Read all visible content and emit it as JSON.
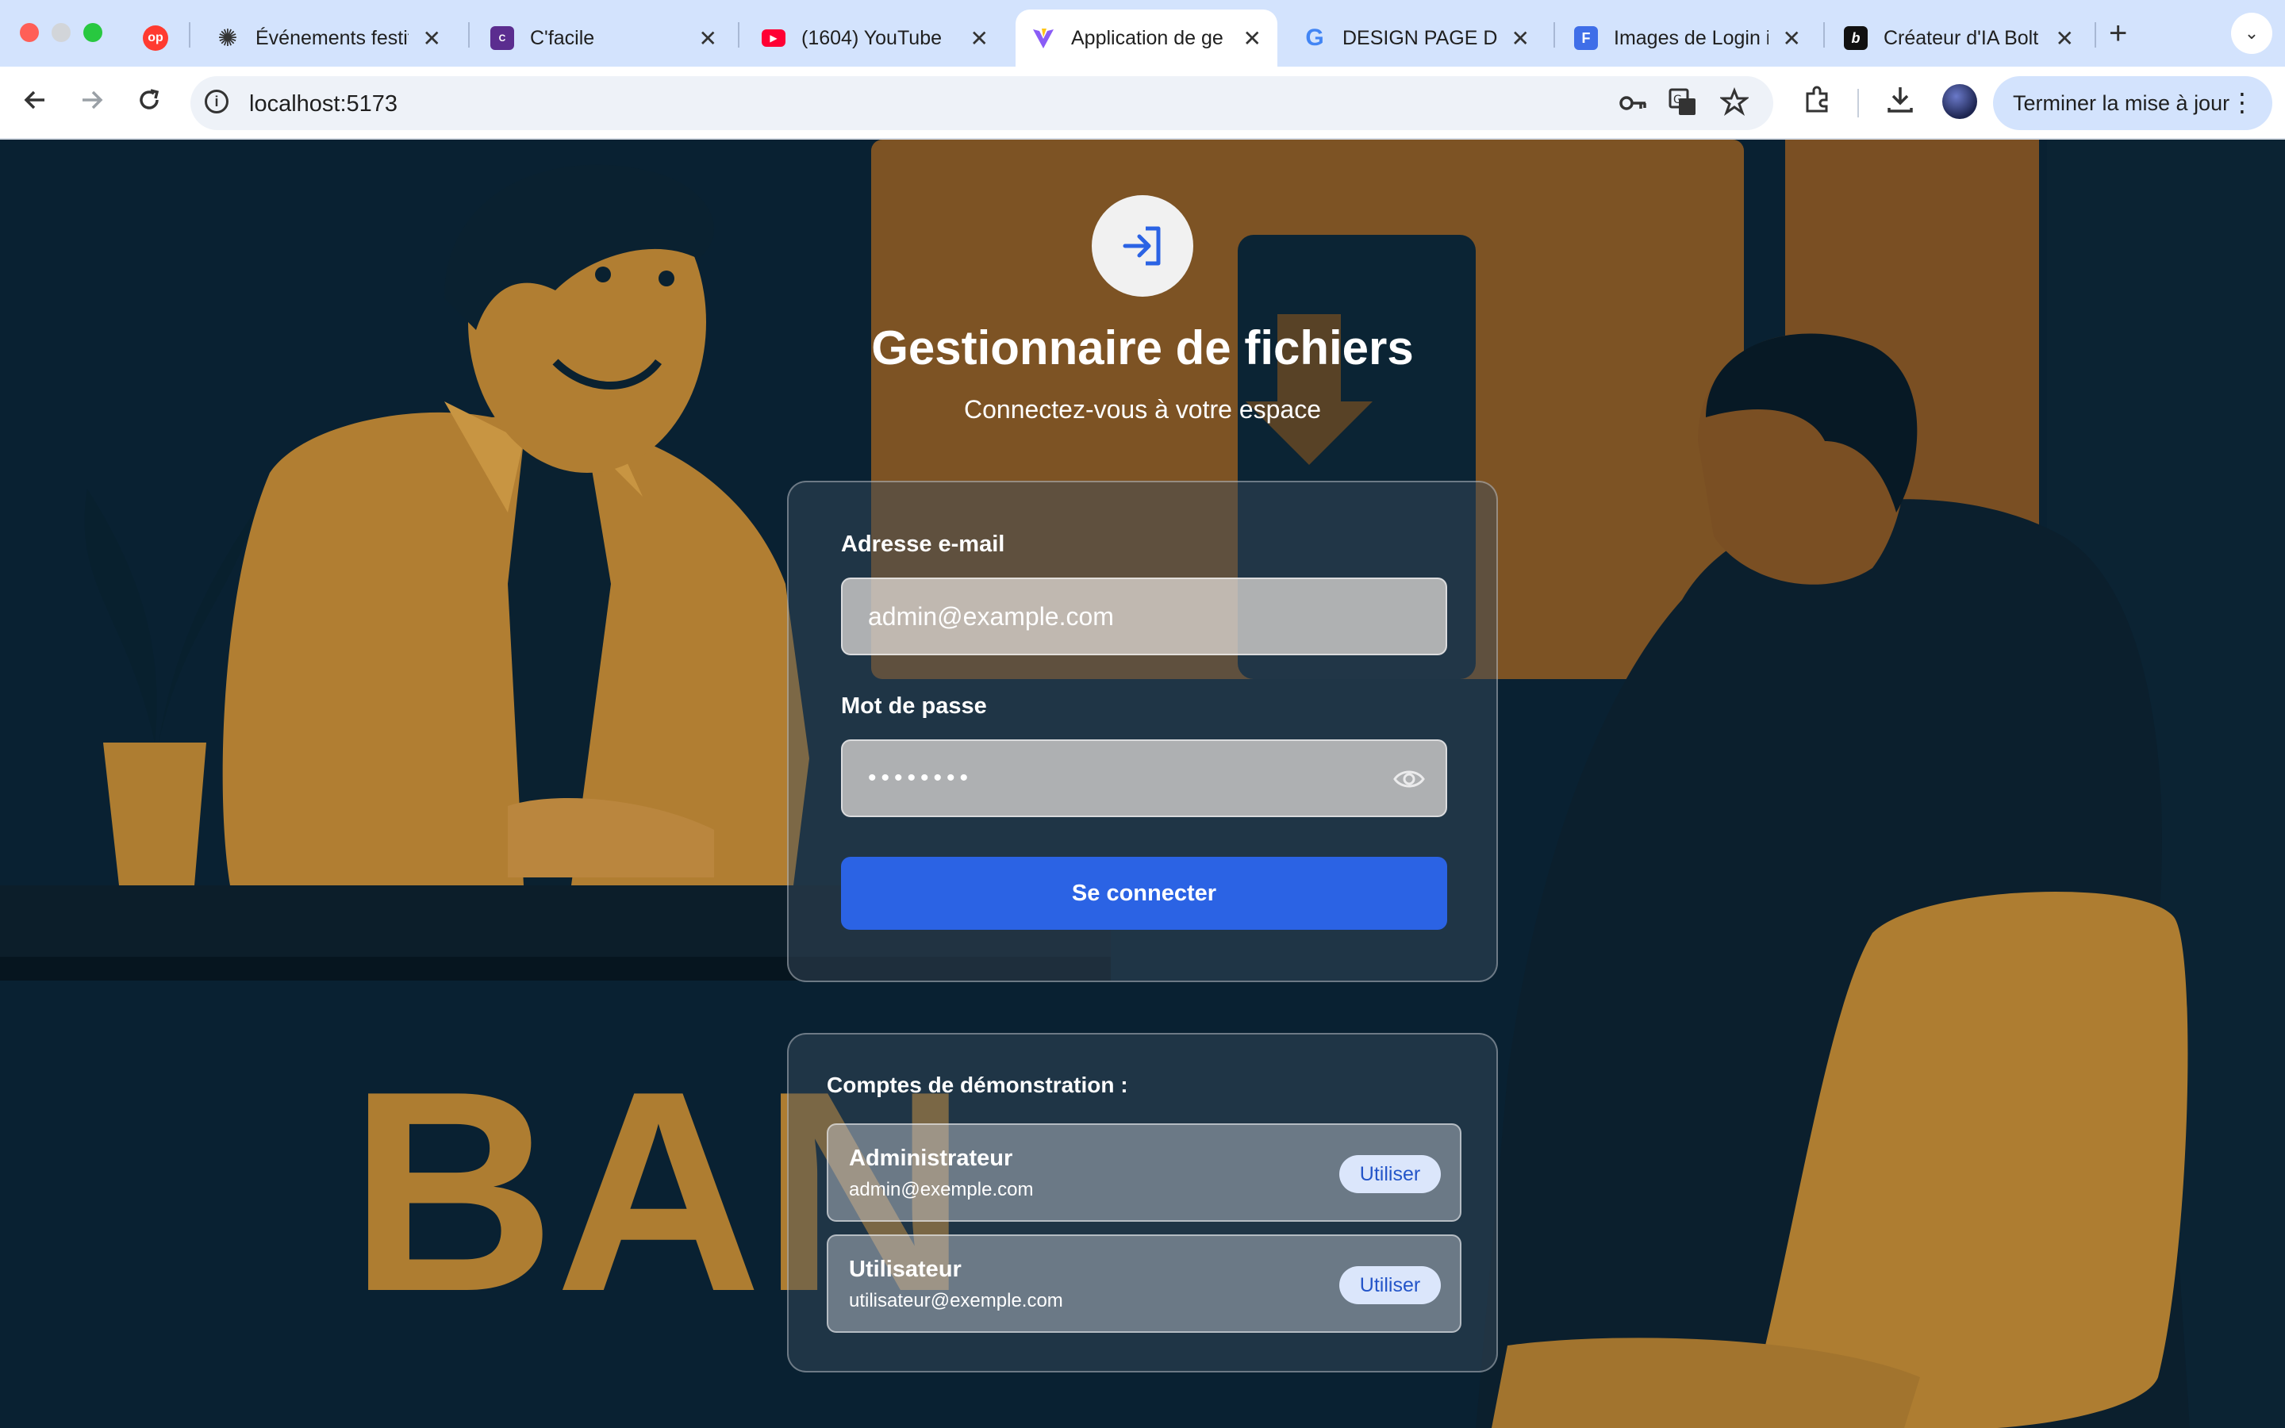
{
  "browser": {
    "tabs": [
      {
        "title": "Événements festif",
        "favicon": "op-icon",
        "favicon_text": "op",
        "favicon_color": "#ff3b30",
        "active": false
      },
      {
        "title": "C'facile",
        "favicon": "cfacile-icon",
        "favicon_text": "C",
        "favicon_color": "#5b2d8f",
        "active": false
      },
      {
        "title": "(1604) YouTube",
        "favicon": "youtube-icon",
        "favicon_text": "▶",
        "favicon_color": "#ff0033",
        "active": false
      },
      {
        "title": "Application de ge",
        "favicon": "vite-icon",
        "favicon_text": "V",
        "favicon_color": "#9b59f6",
        "active": true
      },
      {
        "title": "DESIGN PAGE DE",
        "favicon": "google-icon",
        "favicon_text": "G",
        "favicon_color": "#4285f4",
        "active": false
      },
      {
        "title": "Images de Login i",
        "favicon": "images-icon",
        "favicon_text": "F",
        "favicon_color": "#3f6ee8",
        "active": false
      },
      {
        "title": "Créateur d'IA Bolt",
        "favicon": "bolt-icon",
        "favicon_text": "b",
        "favicon_color": "#111111",
        "active": false
      }
    ],
    "first_tab_favicon": {
      "text": "op",
      "color": "#ff3b30"
    },
    "chatgpt_tab_title": "Événements festif",
    "url": "localhost:5173",
    "update_button_label": "Terminer la mise à jour"
  },
  "login": {
    "title": "Gestionnaire de fichiers",
    "subtitle": "Connectez-vous à votre espace",
    "email_label": "Adresse e-mail",
    "email_value": "admin@example.com",
    "password_label": "Mot de passe",
    "password_value": "••••••••",
    "submit_label": "Se connecter",
    "accent_color": "#2b63e4"
  },
  "demo": {
    "heading": "Comptes de démonstration :",
    "accounts": [
      {
        "name": "Administrateur",
        "email": "admin@exemple.com",
        "button": "Utiliser"
      },
      {
        "name": "Utilisateur",
        "email": "utilisateur@exemple.com",
        "button": "Utiliser"
      }
    ]
  },
  "background": {
    "sign_text": "BAN"
  }
}
